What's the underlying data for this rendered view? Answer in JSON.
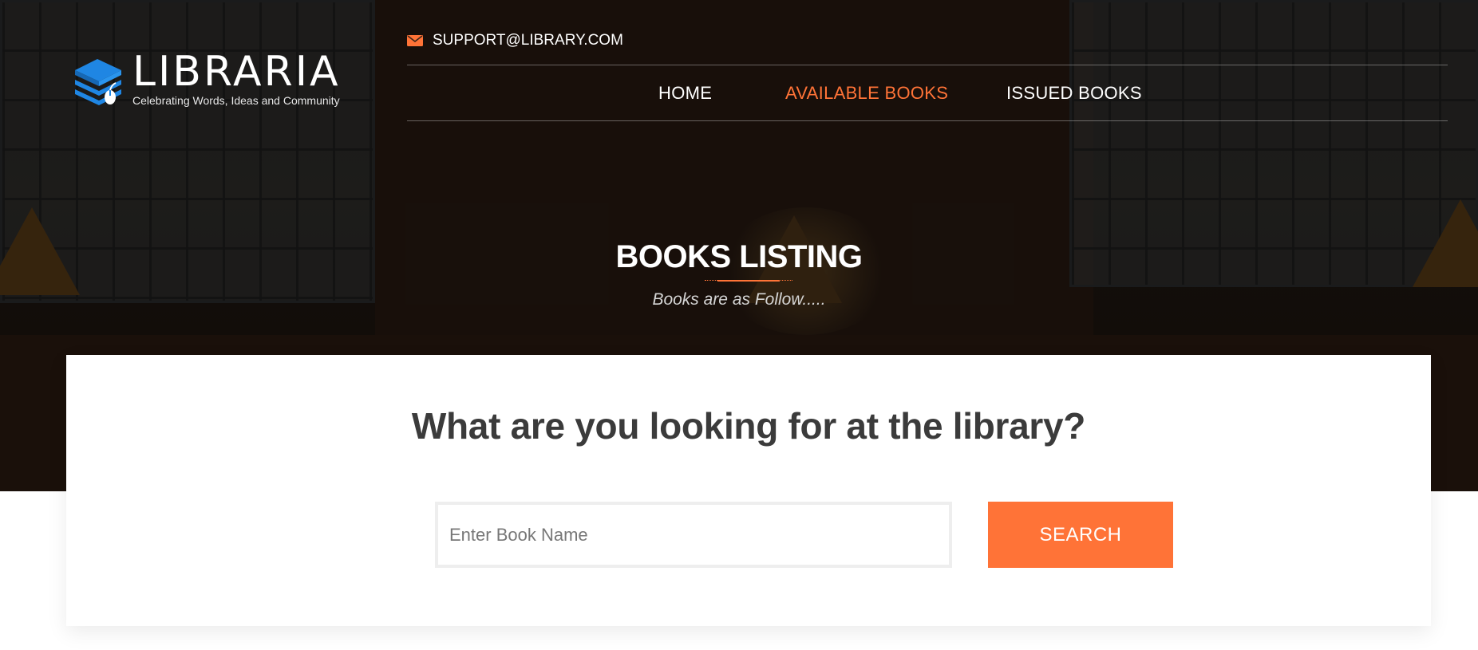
{
  "brand": {
    "name": "LIBRARIA",
    "tagline": "Celebrating Words, Ideas and Community"
  },
  "topbar": {
    "email": "SUPPORT@LIBRARY.COM",
    "email_icon": "envelope-icon"
  },
  "nav": {
    "items": [
      {
        "label": "HOME",
        "active": false
      },
      {
        "label": "AVAILABLE BOOKS",
        "active": true
      },
      {
        "label": "ISSUED BOOKS",
        "active": false
      }
    ]
  },
  "hero": {
    "title": "BOOKS LISTING",
    "subtitle": "Books are as Follow....."
  },
  "search": {
    "heading": "What are you looking for at the library?",
    "placeholder": "Enter Book Name",
    "button_label": "SEARCH"
  },
  "colors": {
    "accent": "#ff7337",
    "logo_blue": "#1f86e3",
    "heading_text": "#3b3b3b"
  }
}
